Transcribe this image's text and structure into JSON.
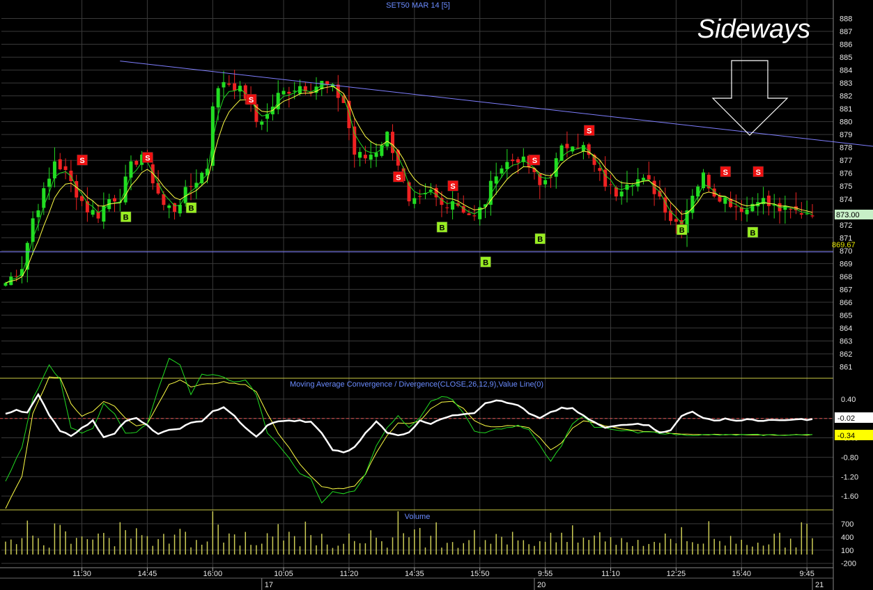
{
  "chart_data": {
    "type": "candlestick",
    "title": "SET50 MAR 14  [5]",
    "annotation": "Sideways",
    "colors": {
      "up": "#22dd22",
      "down": "#ee2222",
      "ma_fast": "#22dd22",
      "ma_slow": "#ffff44",
      "macd": "#ffffff",
      "signal_fast": "#22dd22",
      "signal_slow": "#ffff44",
      "trendline": "#7f7fff",
      "support": "#7f7fff",
      "grid": "#3a3a3a",
      "divider": "#cccc44",
      "volume": "#cccc55",
      "sell_badge": "#ee1111",
      "buy_badge": "#99ee22"
    },
    "price_panel": {
      "ylim": [
        860,
        889
      ],
      "yticks": [
        "861",
        "862",
        "863",
        "864",
        "865",
        "866",
        "867",
        "868",
        "869",
        "870",
        "871",
        "872",
        "873",
        "874",
        "875",
        "876",
        "877",
        "878",
        "879",
        "880",
        "881",
        "882",
        "883",
        "884",
        "885",
        "886",
        "887",
        "888"
      ],
      "last_price_label": "873.00",
      "last_price": 873.0,
      "support_label": "869.67",
      "support_level": 869.9,
      "trendline": {
        "from_index": 21,
        "from_price": 884.7,
        "to_index": 230,
        "to_price": 874.7
      }
    },
    "macd_panel": {
      "title": "Moving Average Convergence / Divergence(CLOSE,26,12,9),Value Line(0)",
      "ylim": [
        -1.9,
        0.8
      ],
      "yticks": [
        "0.40",
        "0.00",
        "-0.40",
        "-0.80",
        "-1.20",
        "-1.60"
      ],
      "value_label_1": "-0.02",
      "value_label_2": "-0.34",
      "zero_line": 0.0
    },
    "volume_panel": {
      "title": "Volume",
      "ylim": [
        -300,
        1000
      ],
      "yticks": [
        "700",
        "400",
        "100",
        "-200"
      ]
    },
    "x_time_labels": [
      {
        "label": "11:30",
        "index": 14
      },
      {
        "label": "14:45",
        "index": 26
      },
      {
        "label": "16:00",
        "index": 38
      },
      {
        "label": "10:05",
        "index": 51
      },
      {
        "label": "11:20",
        "index": 63
      },
      {
        "label": "14:35",
        "index": 75
      },
      {
        "label": "15:50",
        "index": 87
      },
      {
        "label": "9:55",
        "index": 99
      },
      {
        "label": "11:10",
        "index": 111
      },
      {
        "label": "12:25",
        "index": 123
      },
      {
        "label": "15:40",
        "index": 135
      },
      {
        "label": "9:45",
        "index": 147
      }
    ],
    "x_day_labels": [
      {
        "label": "17",
        "index": 47
      },
      {
        "label": "20",
        "index": 97
      },
      {
        "label": "21",
        "index": 148
      }
    ],
    "sell_signals": [
      {
        "label": "S",
        "index": 14,
        "price": 877.0
      },
      {
        "label": "S",
        "index": 26,
        "price": 877.2
      },
      {
        "label": "S",
        "index": 45,
        "price": 881.7
      },
      {
        "label": "S",
        "index": 72,
        "price": 875.7
      },
      {
        "label": "S",
        "index": 82,
        "price": 875.0
      },
      {
        "label": "S",
        "index": 97,
        "price": 877.0
      },
      {
        "label": "S",
        "index": 107,
        "price": 879.3
      },
      {
        "label": "S",
        "index": 132,
        "price": 876.1
      },
      {
        "label": "S",
        "index": 138,
        "price": 876.1
      }
    ],
    "buy_signals": [
      {
        "label": "B",
        "index": 22,
        "price": 872.6
      },
      {
        "label": "B",
        "index": 34,
        "price": 873.3
      },
      {
        "label": "B",
        "index": 80,
        "price": 871.8
      },
      {
        "label": "B",
        "index": 88,
        "price": 869.1
      },
      {
        "label": "B",
        "index": 98,
        "price": 870.9
      },
      {
        "label": "B",
        "index": 124,
        "price": 871.6
      },
      {
        "label": "B",
        "index": 137,
        "price": 871.4
      }
    ],
    "close_anchors": [
      [
        0,
        867.5
      ],
      [
        3,
        868.8
      ],
      [
        5,
        872.5
      ],
      [
        8,
        875.5
      ],
      [
        9,
        877.0
      ],
      [
        11,
        876.0
      ],
      [
        13,
        874.5
      ],
      [
        15,
        873.2
      ],
      [
        17,
        872.8
      ],
      [
        19,
        874.0
      ],
      [
        21,
        874.2
      ],
      [
        23,
        876.5
      ],
      [
        25,
        877.5
      ],
      [
        27,
        875.5
      ],
      [
        29,
        873.5
      ],
      [
        31,
        873.2
      ],
      [
        33,
        874.5
      ],
      [
        35,
        875.5
      ],
      [
        37,
        876.5
      ],
      [
        38,
        881.5
      ],
      [
        40,
        883.2
      ],
      [
        42,
        882.8
      ],
      [
        44,
        882.0
      ],
      [
        46,
        880.0
      ],
      [
        48,
        880.5
      ],
      [
        50,
        882.0
      ],
      [
        52,
        882.5
      ],
      [
        54,
        882.8
      ],
      [
        56,
        882.6
      ],
      [
        58,
        883.0
      ],
      [
        60,
        882.5
      ],
      [
        62,
        881.5
      ],
      [
        64,
        877.5
      ],
      [
        66,
        877.2
      ],
      [
        68,
        877.8
      ],
      [
        70,
        879.0
      ],
      [
        72,
        876.8
      ],
      [
        74,
        873.5
      ],
      [
        76,
        873.8
      ],
      [
        78,
        874.5
      ],
      [
        80,
        873.5
      ],
      [
        82,
        874.0
      ],
      [
        84,
        873.2
      ],
      [
        86,
        872.5
      ],
      [
        88,
        873.8
      ],
      [
        90,
        876.2
      ],
      [
        92,
        876.8
      ],
      [
        94,
        877.2
      ],
      [
        96,
        876.5
      ],
      [
        98,
        875.0
      ],
      [
        100,
        876.0
      ],
      [
        102,
        877.8
      ],
      [
        104,
        878.5
      ],
      [
        106,
        878.0
      ],
      [
        108,
        876.5
      ],
      [
        110,
        875.2
      ],
      [
        112,
        874.5
      ],
      [
        114,
        875.5
      ],
      [
        116,
        875.5
      ],
      [
        118,
        875.2
      ],
      [
        120,
        874.2
      ],
      [
        122,
        872.5
      ],
      [
        124,
        872.0
      ],
      [
        126,
        874.5
      ],
      [
        128,
        875.8
      ],
      [
        130,
        874.5
      ],
      [
        132,
        874.0
      ],
      [
        134,
        873.5
      ],
      [
        136,
        873.2
      ],
      [
        138,
        874.2
      ],
      [
        140,
        873.5
      ],
      [
        142,
        873.2
      ],
      [
        144,
        873.0
      ],
      [
        146,
        873.0
      ],
      [
        147,
        873.0
      ]
    ],
    "macd_anchors": [
      [
        0,
        0.1
      ],
      [
        2,
        0.18
      ],
      [
        4,
        0.12
      ],
      [
        6,
        0.48
      ],
      [
        8,
        0.08
      ],
      [
        10,
        -0.25
      ],
      [
        12,
        -0.35
      ],
      [
        14,
        -0.2
      ],
      [
        16,
        -0.05
      ],
      [
        18,
        -0.38
      ],
      [
        20,
        -0.3
      ],
      [
        22,
        -0.05
      ],
      [
        24,
        0.0
      ],
      [
        26,
        -0.15
      ],
      [
        28,
        -0.32
      ],
      [
        30,
        -0.25
      ],
      [
        32,
        -0.2
      ],
      [
        34,
        -0.1
      ],
      [
        36,
        -0.05
      ],
      [
        38,
        0.15
      ],
      [
        40,
        0.22
      ],
      [
        42,
        0.05
      ],
      [
        44,
        -0.2
      ],
      [
        46,
        -0.38
      ],
      [
        48,
        -0.15
      ],
      [
        50,
        -0.05
      ],
      [
        52,
        -0.05
      ],
      [
        54,
        -0.05
      ],
      [
        56,
        -0.08
      ],
      [
        58,
        -0.3
      ],
      [
        60,
        -0.65
      ],
      [
        62,
        -0.7
      ],
      [
        64,
        -0.6
      ],
      [
        66,
        -0.3
      ],
      [
        68,
        -0.05
      ],
      [
        70,
        -0.3
      ],
      [
        72,
        -0.35
      ],
      [
        74,
        -0.28
      ],
      [
        76,
        -0.05
      ],
      [
        78,
        -0.1
      ],
      [
        80,
        0.0
      ],
      [
        82,
        0.05
      ],
      [
        84,
        0.1
      ],
      [
        86,
        0.12
      ],
      [
        88,
        0.32
      ],
      [
        90,
        0.38
      ],
      [
        92,
        0.32
      ],
      [
        94,
        0.28
      ],
      [
        96,
        0.1
      ],
      [
        98,
        0.0
      ],
      [
        100,
        0.12
      ],
      [
        102,
        0.22
      ],
      [
        104,
        0.2
      ],
      [
        106,
        0.05
      ],
      [
        108,
        -0.08
      ],
      [
        110,
        -0.2
      ],
      [
        112,
        -0.15
      ],
      [
        114,
        -0.12
      ],
      [
        116,
        -0.1
      ],
      [
        118,
        -0.15
      ],
      [
        120,
        -0.28
      ],
      [
        122,
        -0.25
      ],
      [
        124,
        0.05
      ],
      [
        126,
        0.15
      ],
      [
        128,
        0.0
      ],
      [
        130,
        -0.05
      ],
      [
        132,
        0.0
      ],
      [
        134,
        -0.05
      ],
      [
        136,
        -0.02
      ],
      [
        138,
        -0.05
      ],
      [
        140,
        -0.03
      ],
      [
        142,
        -0.05
      ],
      [
        144,
        -0.03
      ],
      [
        146,
        -0.02
      ],
      [
        147,
        -0.02
      ]
    ],
    "signal_fast_anchors": [
      [
        0,
        -1.3
      ],
      [
        3,
        -0.6
      ],
      [
        5,
        0.4
      ],
      [
        8,
        1.1
      ],
      [
        10,
        0.8
      ],
      [
        12,
        -0.2
      ],
      [
        14,
        -0.3
      ],
      [
        16,
        -0.2
      ],
      [
        18,
        0.3
      ],
      [
        20,
        0.1
      ],
      [
        22,
        -0.3
      ],
      [
        24,
        -0.3
      ],
      [
        26,
        -0.1
      ],
      [
        28,
        0.6
      ],
      [
        30,
        1.25
      ],
      [
        32,
        1.1
      ],
      [
        34,
        0.5
      ],
      [
        36,
        0.9
      ],
      [
        38,
        0.9
      ],
      [
        40,
        0.85
      ],
      [
        42,
        0.75
      ],
      [
        44,
        0.8
      ],
      [
        46,
        0.5
      ],
      [
        48,
        -0.3
      ],
      [
        50,
        -0.55
      ],
      [
        52,
        -0.8
      ],
      [
        54,
        -1.15
      ],
      [
        56,
        -1.25
      ],
      [
        58,
        -1.75
      ],
      [
        60,
        -1.5
      ],
      [
        62,
        -1.55
      ],
      [
        64,
        -1.5
      ],
      [
        66,
        -1.15
      ],
      [
        68,
        -0.55
      ],
      [
        70,
        -0.2
      ],
      [
        72,
        0.05
      ],
      [
        74,
        -0.2
      ],
      [
        76,
        0.0
      ],
      [
        78,
        0.35
      ],
      [
        80,
        0.45
      ],
      [
        82,
        0.4
      ],
      [
        84,
        0.1
      ],
      [
        86,
        -0.25
      ],
      [
        88,
        -0.3
      ],
      [
        90,
        -0.22
      ],
      [
        92,
        -0.2
      ],
      [
        94,
        -0.15
      ],
      [
        96,
        -0.22
      ],
      [
        98,
        -0.55
      ],
      [
        100,
        -0.88
      ],
      [
        102,
        -0.55
      ],
      [
        104,
        -0.1
      ],
      [
        106,
        0.05
      ],
      [
        108,
        -0.18
      ],
      [
        110,
        -0.2
      ],
      [
        112,
        -0.25
      ],
      [
        114,
        -0.25
      ],
      [
        116,
        -0.3
      ],
      [
        118,
        -0.28
      ],
      [
        120,
        -0.3
      ],
      [
        122,
        -0.32
      ],
      [
        124,
        -0.34
      ],
      [
        126,
        -0.34
      ],
      [
        147,
        -0.34
      ]
    ],
    "signal_slow_anchors": [
      [
        0,
        -1.85
      ],
      [
        3,
        -1.2
      ],
      [
        5,
        0.1
      ],
      [
        8,
        0.85
      ],
      [
        10,
        0.85
      ],
      [
        12,
        0.3
      ],
      [
        14,
        0.05
      ],
      [
        16,
        0.15
      ],
      [
        18,
        0.35
      ],
      [
        20,
        0.25
      ],
      [
        22,
        0.0
      ],
      [
        24,
        -0.15
      ],
      [
        26,
        -0.1
      ],
      [
        28,
        0.3
      ],
      [
        30,
        0.7
      ],
      [
        32,
        0.8
      ],
      [
        34,
        0.65
      ],
      [
        36,
        0.7
      ],
      [
        38,
        0.72
      ],
      [
        40,
        0.75
      ],
      [
        42,
        0.72
      ],
      [
        44,
        0.7
      ],
      [
        46,
        0.55
      ],
      [
        48,
        0.1
      ],
      [
        50,
        -0.3
      ],
      [
        52,
        -0.6
      ],
      [
        54,
        -0.95
      ],
      [
        56,
        -1.2
      ],
      [
        58,
        -1.4
      ],
      [
        60,
        -1.45
      ],
      [
        62,
        -1.45
      ],
      [
        64,
        -1.4
      ],
      [
        66,
        -1.15
      ],
      [
        68,
        -0.7
      ],
      [
        70,
        -0.35
      ],
      [
        72,
        -0.1
      ],
      [
        74,
        -0.1
      ],
      [
        76,
        -0.05
      ],
      [
        78,
        0.2
      ],
      [
        80,
        0.33
      ],
      [
        82,
        0.35
      ],
      [
        84,
        0.2
      ],
      [
        86,
        -0.05
      ],
      [
        88,
        -0.15
      ],
      [
        90,
        -0.18
      ],
      [
        92,
        -0.15
      ],
      [
        94,
        -0.15
      ],
      [
        96,
        -0.2
      ],
      [
        98,
        -0.4
      ],
      [
        100,
        -0.65
      ],
      [
        102,
        -0.5
      ],
      [
        104,
        -0.2
      ],
      [
        106,
        -0.05
      ],
      [
        108,
        -0.1
      ],
      [
        110,
        -0.15
      ],
      [
        112,
        -0.2
      ],
      [
        114,
        -0.22
      ],
      [
        116,
        -0.25
      ],
      [
        118,
        -0.27
      ],
      [
        120,
        -0.28
      ],
      [
        122,
        -0.3
      ],
      [
        124,
        -0.32
      ],
      [
        126,
        -0.33
      ],
      [
        147,
        -0.34
      ]
    ]
  }
}
